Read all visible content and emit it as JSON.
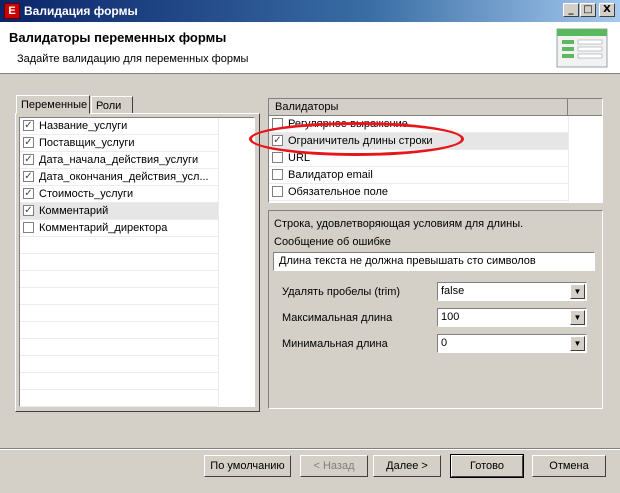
{
  "window": {
    "title": "Валидация формы",
    "app_icon_letter": "E",
    "controls": {
      "minimize": "_",
      "maximize": "□",
      "close": "X"
    }
  },
  "header": {
    "title": "Валидаторы переменных формы",
    "subtitle": "Задайте валидацию для переменных формы"
  },
  "left_tabs": [
    {
      "label": "Переменные",
      "active": true
    },
    {
      "label": "Роли",
      "active": false
    }
  ],
  "variables": [
    {
      "label": "Название_услуги",
      "checked": true
    },
    {
      "label": "Поставщик_услуги",
      "checked": true
    },
    {
      "label": "Дата_начала_действия_услуги",
      "checked": true
    },
    {
      "label": "Дата_окончания_действия_усл...",
      "checked": true
    },
    {
      "label": "Стоимость_услуги",
      "checked": true
    },
    {
      "label": "Комментарий",
      "checked": true,
      "selected": true
    },
    {
      "label": "Комментарий_директора",
      "checked": false
    }
  ],
  "validators": {
    "header": "Валидаторы",
    "items": [
      {
        "label": "Регулярное выражение",
        "checked": false
      },
      {
        "label": "Ограничитель длины строки",
        "checked": true,
        "selected": true
      },
      {
        "label": "URL",
        "checked": false
      },
      {
        "label": "Валидатор email",
        "checked": false
      },
      {
        "label": "Обязательное поле",
        "checked": false
      }
    ]
  },
  "details": {
    "description": "Строка, удовлетворяющая условиям для длины.",
    "error_label": "Сообщение об ошибке",
    "error_value": "Длина текста не должна превышать сто символов",
    "fields": [
      {
        "label": "Удалять пробелы (trim)",
        "value": "false"
      },
      {
        "label": "Максимальная длина",
        "value": "100"
      },
      {
        "label": "Минимальная длина",
        "value": "0"
      }
    ]
  },
  "buttons": {
    "defaults": "По умолчанию",
    "back": "< Назад",
    "next": "Далее >",
    "finish": "Готово",
    "cancel": "Отмена"
  },
  "colors": {
    "highlight_ellipse": "#e8161b",
    "title_bar": "#0a246a"
  }
}
